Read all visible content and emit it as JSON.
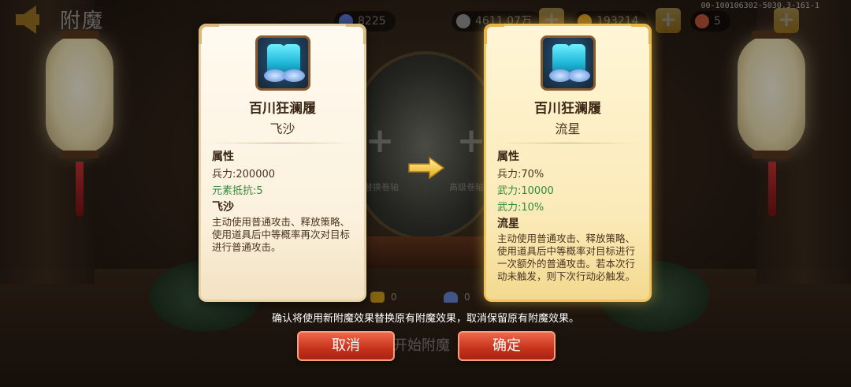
{
  "header": {
    "title": "附魔",
    "version": "00-100106302-5030.3-161-1",
    "resources": [
      {
        "value": "8225",
        "icon": "diamond-icon"
      },
      {
        "value": "4611.07万",
        "icon": "coin-icon"
      },
      {
        "value": "193214",
        "icon": "ingot-icon"
      },
      {
        "value": "5",
        "icon": "meat-icon"
      }
    ]
  },
  "background": {
    "slot_left_label": "替换卷轴",
    "slot_right_label": "高级卷轴",
    "start_button_label": "开始附魔",
    "material_counts": [
      "0",
      "0"
    ]
  },
  "old_card": {
    "item_name": "百川狂澜履",
    "enchant_name": "飞沙",
    "attributes_label": "属性",
    "stats": [
      {
        "text": "兵力:200000",
        "green": false
      },
      {
        "text": "元素抵抗:5",
        "green": true
      }
    ],
    "effect_title": "飞沙",
    "effect_desc": "主动使用普通攻击、释放策略、使用道具后中等概率再次对目标进行普通攻击。"
  },
  "new_card": {
    "item_name": "百川狂澜履",
    "enchant_name": "流星",
    "attributes_label": "属性",
    "stats": [
      {
        "text": "兵力:70%",
        "green": false
      },
      {
        "text": "武力:10000",
        "green": true
      },
      {
        "text": "武力:10%",
        "green": true
      }
    ],
    "effect_title": "流星",
    "effect_desc": "主动使用普通攻击、释放策略、使用道具后中等概率对目标进行一次额外的普通攻击。若本次行动未触发，则下次行动必触发。"
  },
  "dialog": {
    "confirm_text": "确认将使用新附魔效果替换原有附魔效果，取消保留原有附魔效果。",
    "cancel_label": "取消",
    "ok_label": "确定"
  },
  "colors": {
    "accent_gold": "#f2b52c",
    "button_red": "#c6321c",
    "stat_green": "#2f8a3c"
  }
}
